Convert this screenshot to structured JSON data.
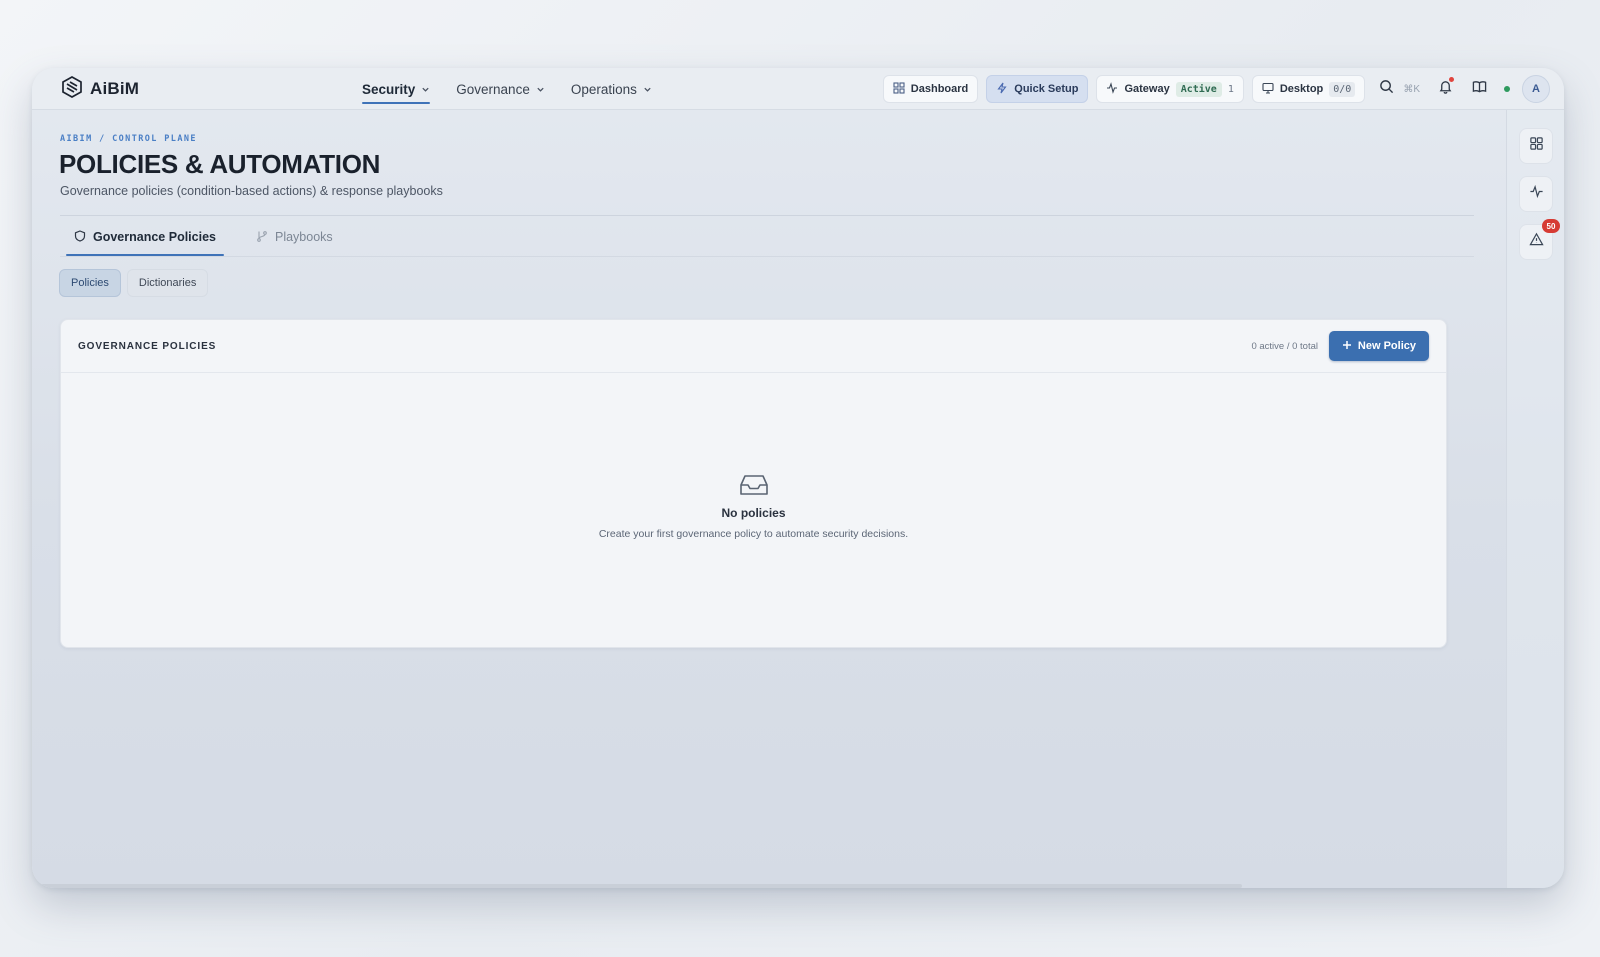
{
  "app": {
    "name": "AiBiM"
  },
  "nav": {
    "items": [
      {
        "label": "Security",
        "active": true
      },
      {
        "label": "Governance",
        "active": false
      },
      {
        "label": "Operations",
        "active": false
      }
    ]
  },
  "toolbar": {
    "dashboard_label": "Dashboard",
    "quick_setup_label": "Quick Setup",
    "gateway_label": "Gateway",
    "gateway_status": "Active",
    "gateway_count": "1",
    "desktop_label": "Desktop",
    "desktop_count": "0/0",
    "search_shortcut": "⌘K",
    "user_initial": "A"
  },
  "rail": {
    "alerts_badge": "50"
  },
  "page": {
    "breadcrumb": "AIBIM / CONTROL PLANE",
    "title": "POLICIES & AUTOMATION",
    "subtitle": "Governance policies (condition-based actions) & response playbooks"
  },
  "tabs": [
    {
      "label": "Governance Policies",
      "active": true
    },
    {
      "label": "Playbooks",
      "active": false
    }
  ],
  "subtabs": [
    {
      "label": "Policies",
      "active": true
    },
    {
      "label": "Dictionaries",
      "active": false
    }
  ],
  "card": {
    "title": "GOVERNANCE POLICIES",
    "count": "0 active / 0 total",
    "new_button": "New Policy",
    "empty_title": "No policies",
    "empty_desc": "Create your first governance policy to automate security decisions."
  },
  "colors": {
    "accent": "#3b6fb0",
    "badge": "#d63b34",
    "status_green": "#2e9a5e"
  }
}
